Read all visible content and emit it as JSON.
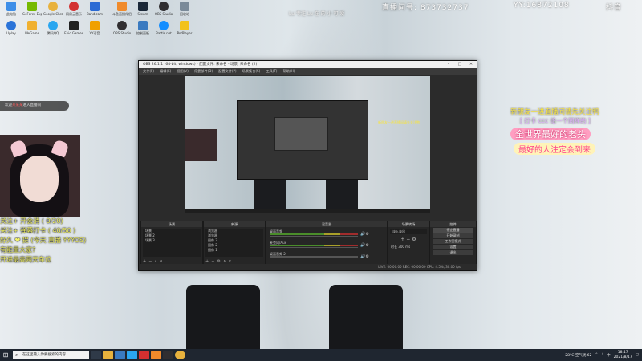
{
  "desktop": {
    "icons": [
      {
        "label": "此电脑",
        "color": "#3d8ee8"
      },
      {
        "label": "GeForce Experience",
        "color": "#76b900"
      },
      {
        "label": "Google Chrome",
        "color": "#e8b23d"
      },
      {
        "label": "网易云音乐",
        "color": "#d33030"
      },
      {
        "label": "Bandicam",
        "color": "#2a6ad4"
      },
      {
        "label": "斗鱼直播伴侣",
        "color": "#f08a2b"
      },
      {
        "label": "Steam",
        "color": "#1b2838"
      },
      {
        "label": "OBS Studio",
        "color": "#302e31"
      },
      {
        "label": "回收站",
        "color": "#7a8a99"
      },
      {
        "label": "Uplay",
        "color": "#2a73d8"
      },
      {
        "label": "WeGame",
        "color": "#f0b030"
      },
      {
        "label": "腾讯QQ",
        "color": "#2aa6f0"
      },
      {
        "label": "Epic Games",
        "color": "#222"
      },
      {
        "label": "YY语音",
        "color": "#f0a000"
      },
      {
        "label": "OBS Studio",
        "color": "#302e31"
      },
      {
        "label": "控制面板",
        "color": "#3a7ac0"
      },
      {
        "label": "Battle.net",
        "color": "#148eff"
      },
      {
        "label": "PotPlayer",
        "color": "#f2c21b"
      }
    ]
  },
  "overlay": {
    "top_number_1": "直播间号: 873732737",
    "top_number_2": "YY:16872108",
    "top_right_tag": "抖音",
    "mid_top": "Lu 专注 Lu 在 的 小 可 爱",
    "live_tag_prefix": "欢迎",
    "live_tag_name": "某某某",
    "live_tag_suffix": "进入直播间",
    "left_lines": [
      "关注+ 开会消 ( 0/20)",
      "关注+ 弹幕打卡 ( 40/50 )",
      "好久 ❤ 提 (今天 直播 YYYOS)",
      "有能量大家?",
      "开进最高两天车位"
    ],
    "right_line_1": "新朋友一进直播间请先关注鸭",
    "right_line_2": "[ 打卡 ccc 给一个同样的 ]",
    "right_banner_1": "全世界最好的老头",
    "right_banner_2": "最好的人注定会到来"
  },
  "obs": {
    "title": "OBS 26.1.1 (64-bit, windows) - 配置文件: 未命名 - 场景: 未命名 (2)",
    "menu": [
      "文件(F)",
      "编辑(E)",
      "视图(V)",
      "停靠部件(D)",
      "配置文件(P)",
      "场景集合(S)",
      "工具(T)",
      "帮助(H)"
    ],
    "docks": {
      "scenes": {
        "title": "场景",
        "items": [
          "场景",
          "场景 2",
          "场景 3"
        ]
      },
      "sources": {
        "title": "来源",
        "items": [
          "浏览器",
          "浏览器",
          "图像 3",
          "图像 2",
          "图像 1"
        ]
      },
      "mixer": {
        "title": "混音器",
        "rows": [
          {
            "label": "桌面音频",
            "db": "0.0 dB"
          },
          {
            "label": "麦克风/Aux",
            "db": "0.0 dB"
          },
          {
            "label": "桌面音频 2",
            "db": "0.0 dB"
          }
        ]
      },
      "transitions": {
        "title": "场景转场",
        "type": "淡入淡出",
        "duration": "时长 300 ms"
      },
      "controls": {
        "title": "控件",
        "buttons": [
          "停止直播",
          "开始录制",
          "工作室模式",
          "设置",
          "退出"
        ]
      }
    },
    "status": "LIVE: 00:00:00   REC: 00:00:00   CPU: 4.5%, 30.00 fps"
  },
  "taskbar": {
    "search_placeholder": "在这里输入你要搜索的内容",
    "weather": "28°C 空气优 62",
    "time": "18:17",
    "date": "2021/8/17"
  }
}
